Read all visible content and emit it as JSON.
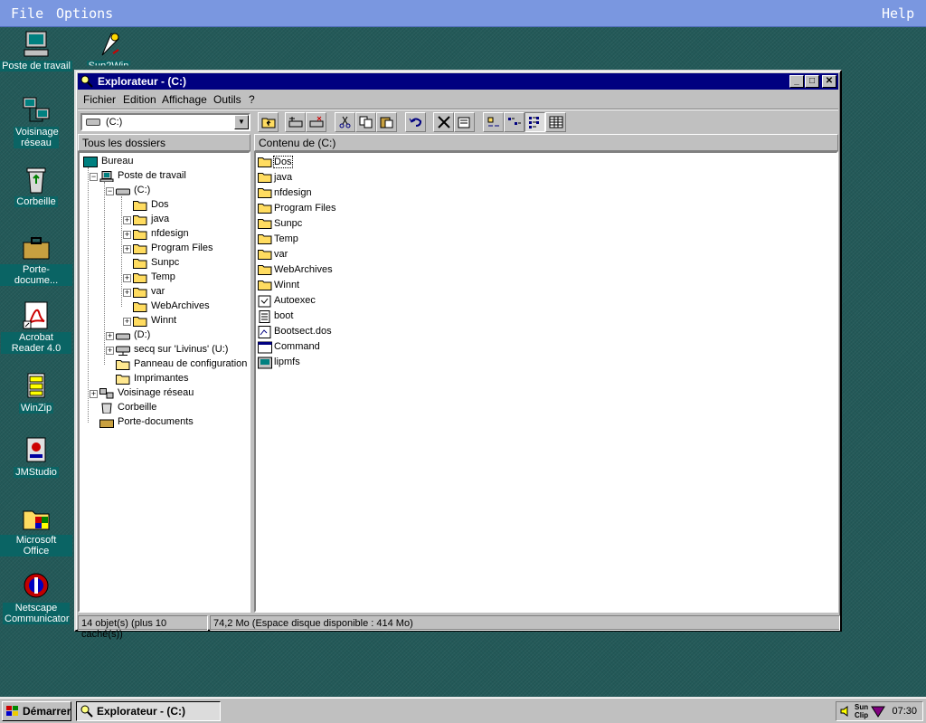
{
  "host_menu": {
    "file": "File",
    "options": "Options",
    "help": "Help"
  },
  "desktop": {
    "icons": [
      {
        "label": "Poste de travail"
      },
      {
        "label": "Sun2Win"
      },
      {
        "label": "Voisinage réseau"
      },
      {
        "label": "Corbeille"
      },
      {
        "label": "Porte-docume..."
      },
      {
        "label": "Acrobat Reader 4.0"
      },
      {
        "label": "WinZip"
      },
      {
        "label": "JMStudio"
      },
      {
        "label": "Microsoft Office"
      },
      {
        "label": "Netscape Communicator"
      }
    ]
  },
  "window": {
    "title": "Explorateur -  (C:)",
    "menu": [
      "Fichier",
      "Edition",
      "Affichage",
      "Outils",
      "?"
    ],
    "address": "(C:)",
    "left_header": "Tous les dossiers",
    "right_header": "Contenu de  (C:)",
    "tree": [
      {
        "label": "Bureau",
        "level": 0,
        "exp": ""
      },
      {
        "label": "Poste de travail",
        "level": 1,
        "exp": "−"
      },
      {
        "label": "(C:)",
        "level": 2,
        "exp": "−"
      },
      {
        "label": "Dos",
        "level": 3,
        "exp": ""
      },
      {
        "label": "java",
        "level": 3,
        "exp": "+"
      },
      {
        "label": "nfdesign",
        "level": 3,
        "exp": "+"
      },
      {
        "label": "Program Files",
        "level": 3,
        "exp": "+"
      },
      {
        "label": "Sunpc",
        "level": 3,
        "exp": ""
      },
      {
        "label": "Temp",
        "level": 3,
        "exp": "+"
      },
      {
        "label": "var",
        "level": 3,
        "exp": "+"
      },
      {
        "label": "WebArchives",
        "level": 3,
        "exp": ""
      },
      {
        "label": "Winnt",
        "level": 3,
        "exp": "+"
      },
      {
        "label": "(D:)",
        "level": 2,
        "exp": "+"
      },
      {
        "label": "secq sur 'Livinus' (U:)",
        "level": 2,
        "exp": "+"
      },
      {
        "label": "Panneau de configuration",
        "level": 2,
        "exp": ""
      },
      {
        "label": "Imprimantes",
        "level": 2,
        "exp": ""
      },
      {
        "label": "Voisinage réseau",
        "level": 1,
        "exp": "+"
      },
      {
        "label": "Corbeille",
        "level": 1,
        "exp": ""
      },
      {
        "label": "Porte-documents",
        "level": 1,
        "exp": ""
      }
    ],
    "files": [
      {
        "name": "Dos",
        "kind": "folder"
      },
      {
        "name": "java",
        "kind": "folder"
      },
      {
        "name": "nfdesign",
        "kind": "folder"
      },
      {
        "name": "Program Files",
        "kind": "folder"
      },
      {
        "name": "Sunpc",
        "kind": "folder"
      },
      {
        "name": "Temp",
        "kind": "folder"
      },
      {
        "name": "var",
        "kind": "folder"
      },
      {
        "name": "WebArchives",
        "kind": "folder"
      },
      {
        "name": "Winnt",
        "kind": "folder"
      },
      {
        "name": "Autoexec",
        "kind": "batch"
      },
      {
        "name": "boot",
        "kind": "text"
      },
      {
        "name": "Bootsect.dos",
        "kind": "file"
      },
      {
        "name": "Command",
        "kind": "program"
      },
      {
        "name": "lipmfs",
        "kind": "program2"
      }
    ],
    "status": {
      "objects": "14 objet(s) (plus 10 caché(s))",
      "space": "74,2 Mo (Espace disque disponible : 414 Mo)"
    }
  },
  "taskbar": {
    "start": "Démarrer",
    "task": "Explorateur -  (C:)",
    "tray_label_1": "Sun",
    "tray_label_2": "Clip",
    "clock": "07:30"
  }
}
